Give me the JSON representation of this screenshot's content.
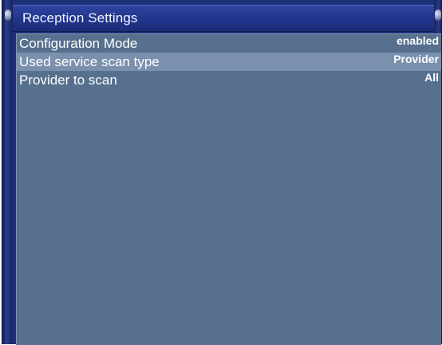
{
  "window": {
    "title": "Reception Settings"
  },
  "settings": {
    "items": [
      {
        "label": "Configuration Mode",
        "value": "enabled",
        "selected": false
      },
      {
        "label": "Used service scan type",
        "value": "Provider",
        "selected": true
      },
      {
        "label": "Provider to scan",
        "value": "All",
        "selected": false
      }
    ]
  },
  "colors": {
    "frame": "#1d2f78",
    "title_bar": "#22358c",
    "content_bg": "#56708e",
    "selected_row": "#7a90ad",
    "text": "#ffffff"
  },
  "icons": {
    "frame_knobs": "knob-icon"
  }
}
